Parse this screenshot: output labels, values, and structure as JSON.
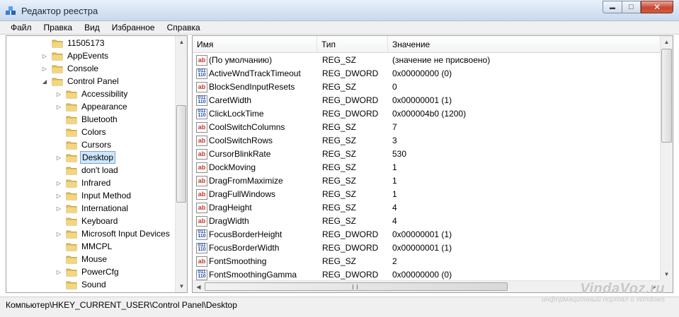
{
  "window": {
    "title": "Редактор реестра",
    "minimize": "▬",
    "maximize": "□",
    "close": "✕"
  },
  "menu": [
    {
      "label": "Файл"
    },
    {
      "label": "Правка"
    },
    {
      "label": "Вид"
    },
    {
      "label": "Избранное"
    },
    {
      "label": "Справка"
    }
  ],
  "tree": {
    "items": [
      {
        "label": "11505173",
        "expander": ""
      },
      {
        "label": "AppEvents",
        "expander": "▷"
      },
      {
        "label": "Console",
        "expander": "▷"
      },
      {
        "label": "Control Panel",
        "expander": "◢"
      },
      {
        "label": "Accessibility",
        "expander": "▷"
      },
      {
        "label": "Appearance",
        "expander": "▷"
      },
      {
        "label": "Bluetooth",
        "expander": ""
      },
      {
        "label": "Colors",
        "expander": ""
      },
      {
        "label": "Cursors",
        "expander": ""
      },
      {
        "label": "Desktop",
        "expander": "▷",
        "selected": true
      },
      {
        "label": "don't load",
        "expander": ""
      },
      {
        "label": "Infrared",
        "expander": "▷"
      },
      {
        "label": "Input Method",
        "expander": "▷"
      },
      {
        "label": "International",
        "expander": "▷"
      },
      {
        "label": "Keyboard",
        "expander": ""
      },
      {
        "label": "Microsoft Input Devices",
        "expander": "▷"
      },
      {
        "label": "MMCPL",
        "expander": ""
      },
      {
        "label": "Mouse",
        "expander": ""
      },
      {
        "label": "PowerCfg",
        "expander": "▷"
      },
      {
        "label": "Sound",
        "expander": ""
      }
    ]
  },
  "list": {
    "columns": {
      "name": "Имя",
      "type": "Тип",
      "value": "Значение"
    },
    "rows": [
      {
        "icon": "ab",
        "name": "(По умолчанию)",
        "type": "REG_SZ",
        "value": "(значение не присвоено)"
      },
      {
        "icon": "bin",
        "name": "ActiveWndTrackTimeout",
        "type": "REG_DWORD",
        "value": "0x00000000 (0)"
      },
      {
        "icon": "ab",
        "name": "BlockSendInputResets",
        "type": "REG_SZ",
        "value": "0"
      },
      {
        "icon": "bin",
        "name": "CaretWidth",
        "type": "REG_DWORD",
        "value": "0x00000001 (1)"
      },
      {
        "icon": "bin",
        "name": "ClickLockTime",
        "type": "REG_DWORD",
        "value": "0x000004b0 (1200)"
      },
      {
        "icon": "ab",
        "name": "CoolSwitchColumns",
        "type": "REG_SZ",
        "value": "7"
      },
      {
        "icon": "ab",
        "name": "CoolSwitchRows",
        "type": "REG_SZ",
        "value": "3"
      },
      {
        "icon": "ab",
        "name": "CursorBlinkRate",
        "type": "REG_SZ",
        "value": "530"
      },
      {
        "icon": "ab",
        "name": "DockMoving",
        "type": "REG_SZ",
        "value": "1"
      },
      {
        "icon": "ab",
        "name": "DragFromMaximize",
        "type": "REG_SZ",
        "value": "1"
      },
      {
        "icon": "ab",
        "name": "DragFullWindows",
        "type": "REG_SZ",
        "value": "1"
      },
      {
        "icon": "ab",
        "name": "DragHeight",
        "type": "REG_SZ",
        "value": "4"
      },
      {
        "icon": "ab",
        "name": "DragWidth",
        "type": "REG_SZ",
        "value": "4"
      },
      {
        "icon": "bin",
        "name": "FocusBorderHeight",
        "type": "REG_DWORD",
        "value": "0x00000001 (1)"
      },
      {
        "icon": "bin",
        "name": "FocusBorderWidth",
        "type": "REG_DWORD",
        "value": "0x00000001 (1)"
      },
      {
        "icon": "ab",
        "name": "FontSmoothing",
        "type": "REG_SZ",
        "value": "2"
      },
      {
        "icon": "bin",
        "name": "FontSmoothingGamma",
        "type": "REG_DWORD",
        "value": "0x00000000 (0)"
      }
    ]
  },
  "icon_glyphs": {
    "ab": "ab",
    "bin": "011\n110"
  },
  "status": {
    "path": "Компьютер\\HKEY_CURRENT_USER\\Control Panel\\Desktop"
  },
  "watermark": {
    "main": "VindaVoz.ru",
    "sub": "информационный портал о Windows"
  },
  "colors": {
    "folder": "#e8c25a",
    "selection": "#cde8ff",
    "title_bar": "#d4e2f2"
  }
}
